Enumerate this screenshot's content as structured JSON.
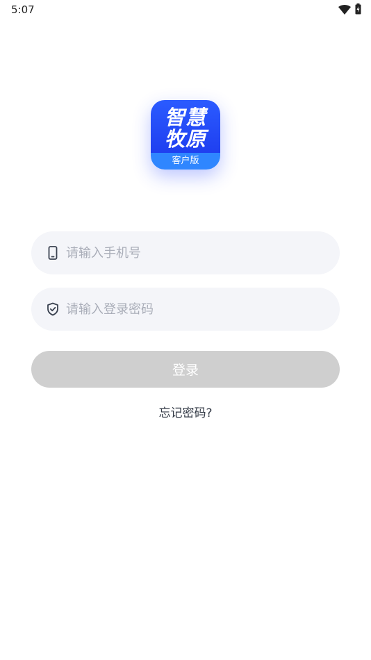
{
  "status_bar": {
    "time": "5:07",
    "icons": [
      "wifi-icon",
      "battery-charging-icon"
    ]
  },
  "logo": {
    "line1": "智慧",
    "line2": "牧原",
    "subtitle": "客户版",
    "colors": {
      "primary": "#2b5bff",
      "secondary": "#2f86ff"
    }
  },
  "form": {
    "phone": {
      "placeholder": "请输入手机号",
      "value": "",
      "icon": "phone-icon"
    },
    "password": {
      "placeholder": "请输入登录密码",
      "value": "",
      "icon": "shield-check-icon"
    },
    "login_label": "登录",
    "forgot_label": "忘记密码?"
  },
  "colors": {
    "field_bg": "#f4f5f9",
    "button_disabled": "#cfcfcf"
  }
}
